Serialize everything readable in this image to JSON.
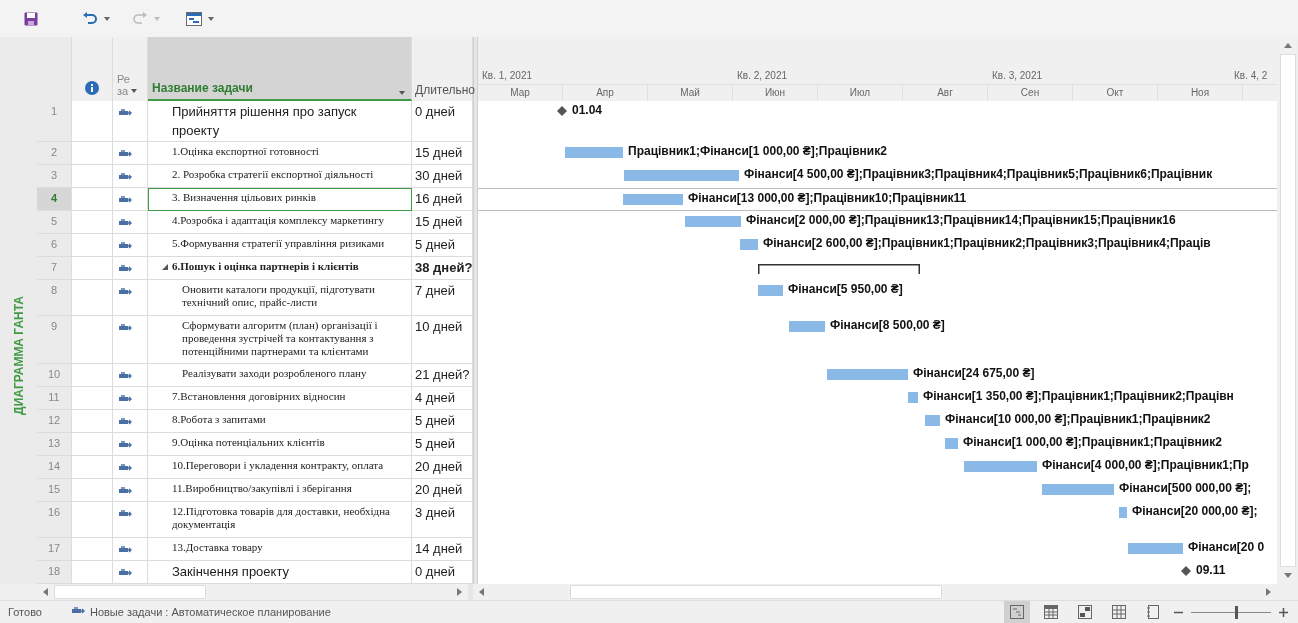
{
  "view_band": {
    "label": "ДИАГРАММА ГАНТА"
  },
  "table": {
    "columns": [
      {
        "label": "Ре",
        "label_2": "за"
      },
      {
        "label": "Название задачи"
      },
      {
        "label": "Длительно"
      }
    ]
  },
  "timeline": {
    "quarters": [
      "Кв. 1, 2021",
      "Кв. 2, 2021",
      "Кв. 3, 2021",
      "Кв. 4, 2"
    ],
    "months": [
      "Мар",
      "Апр",
      "Май",
      "Июн",
      "Июл",
      "Авг",
      "Сен",
      "Окт",
      "Ноя"
    ]
  },
  "tasks": [
    {
      "id": "1",
      "kind": "milestone",
      "name": "Прийняття рішення про запуск проекту",
      "duration": "0 дней",
      "bar_label": "01.04",
      "selected": false
    },
    {
      "id": "2",
      "kind": "task",
      "name": "1.Оцінка експортної готовності",
      "duration": "15 дней",
      "bar_label": "Працівник1;Фінанси[1 000,00 ₴];Працівник2",
      "selected": false
    },
    {
      "id": "3",
      "kind": "task",
      "name": "2. Розробка стратегії експортної діяльності",
      "duration": "30 дней",
      "bar_label": "Фінанси[4 500,00 ₴];Працівник3;Працівник4;Працівник5;Працівник6;Працівник",
      "selected": false
    },
    {
      "id": "4",
      "kind": "task",
      "name": "3. Визначення цільових ринків",
      "duration": "16 дней",
      "bar_label": "Фінанси[13 000,00 ₴];Працівник10;Працівник11",
      "selected": true
    },
    {
      "id": "5",
      "kind": "task",
      "name": "4.Розробка і адаптація комплексу маркетингу",
      "duration": "15 дней",
      "bar_label": "Фінанси[2 000,00 ₴];Працівник13;Працівник14;Працівник15;Працівник16",
      "selected": false
    },
    {
      "id": "6",
      "kind": "task",
      "name": "5.Формування стратегії управління ризиками",
      "duration": "5 дней",
      "bar_label": "Фінанси[2 600,00 ₴];Працівник1;Працівник2;Працівник3;Працівник4;Праців",
      "selected": false
    },
    {
      "id": "7",
      "kind": "summary",
      "name": "6.Пошук і оцінка партнерів і клієнтів",
      "duration": "38 дней?",
      "expanded": true,
      "selected": false,
      "children": [
        {
          "id": "8",
          "kind": "task",
          "name": "Оновити каталоги продукції, підготувати технічний опис, прайс-листи",
          "duration": "7 дней",
          "bar_label": "Фінанси[5 950,00 ₴]",
          "selected": false
        },
        {
          "id": "9",
          "kind": "task",
          "name": "Сформувати алгоритм (план) організації і проведення зустрічей та контактування з потенційними партнерами та клієнтами",
          "duration": "10 дней",
          "bar_label": "Фінанси[8 500,00 ₴]",
          "selected": false
        },
        {
          "id": "10",
          "kind": "task",
          "name": "Реалізувати заходи розробленого плану",
          "duration": "21 дней?",
          "bar_label": "Фінанси[24 675,00 ₴]",
          "selected": false
        }
      ]
    },
    {
      "id": "11",
      "kind": "task",
      "name": "7.Встановлення договірних відносин",
      "duration": "4 дней",
      "bar_label": "Фінанси[1 350,00 ₴];Працівник1;Працівник2;Працівн",
      "selected": false
    },
    {
      "id": "12",
      "kind": "task",
      "name": "8.Робота з запитами",
      "duration": "5 дней",
      "bar_label": "Фінанси[10 000,00 ₴];Працівник1;Працівник2",
      "selected": false
    },
    {
      "id": "13",
      "kind": "task",
      "name": "9.Оцінка потенціальних клієнтів",
      "duration": "5 дней",
      "bar_label": "Фінанси[1 000,00 ₴];Працівник1;Працівник2",
      "selected": false
    },
    {
      "id": "14",
      "kind": "task",
      "name": "10.Переговори і укладення контракту, оплата",
      "duration": "20 дней",
      "bar_label": "Фінанси[4 000,00 ₴];Працівник1;Пр",
      "selected": false
    },
    {
      "id": "15",
      "kind": "task",
      "name": "11.Виробництво/закупівлі і зберігання",
      "duration": "20 дней",
      "bar_label": "Фінанси[500 000,00 ₴];",
      "selected": false
    },
    {
      "id": "16",
      "kind": "task",
      "name": "12.Підготовка товарів для доставки, необхідна документація",
      "duration": "3 дней",
      "bar_label": "Фінанси[20 000,00 ₴];",
      "selected": false
    },
    {
      "id": "17",
      "kind": "task",
      "name": "13.Доставка товару",
      "duration": "14 дней",
      "bar_label": "Фінанси[20 0",
      "selected": false
    },
    {
      "id": "18",
      "kind": "milestone",
      "name": "Закінчення проекту",
      "duration": "0 дней",
      "bar_label": "09.11",
      "selected": false
    }
  ],
  "status_bar": {
    "state": "Готово",
    "mode": "Новые задачи : Автоматическое планирование",
    "zoom": {
      "level": 0.55
    }
  }
}
